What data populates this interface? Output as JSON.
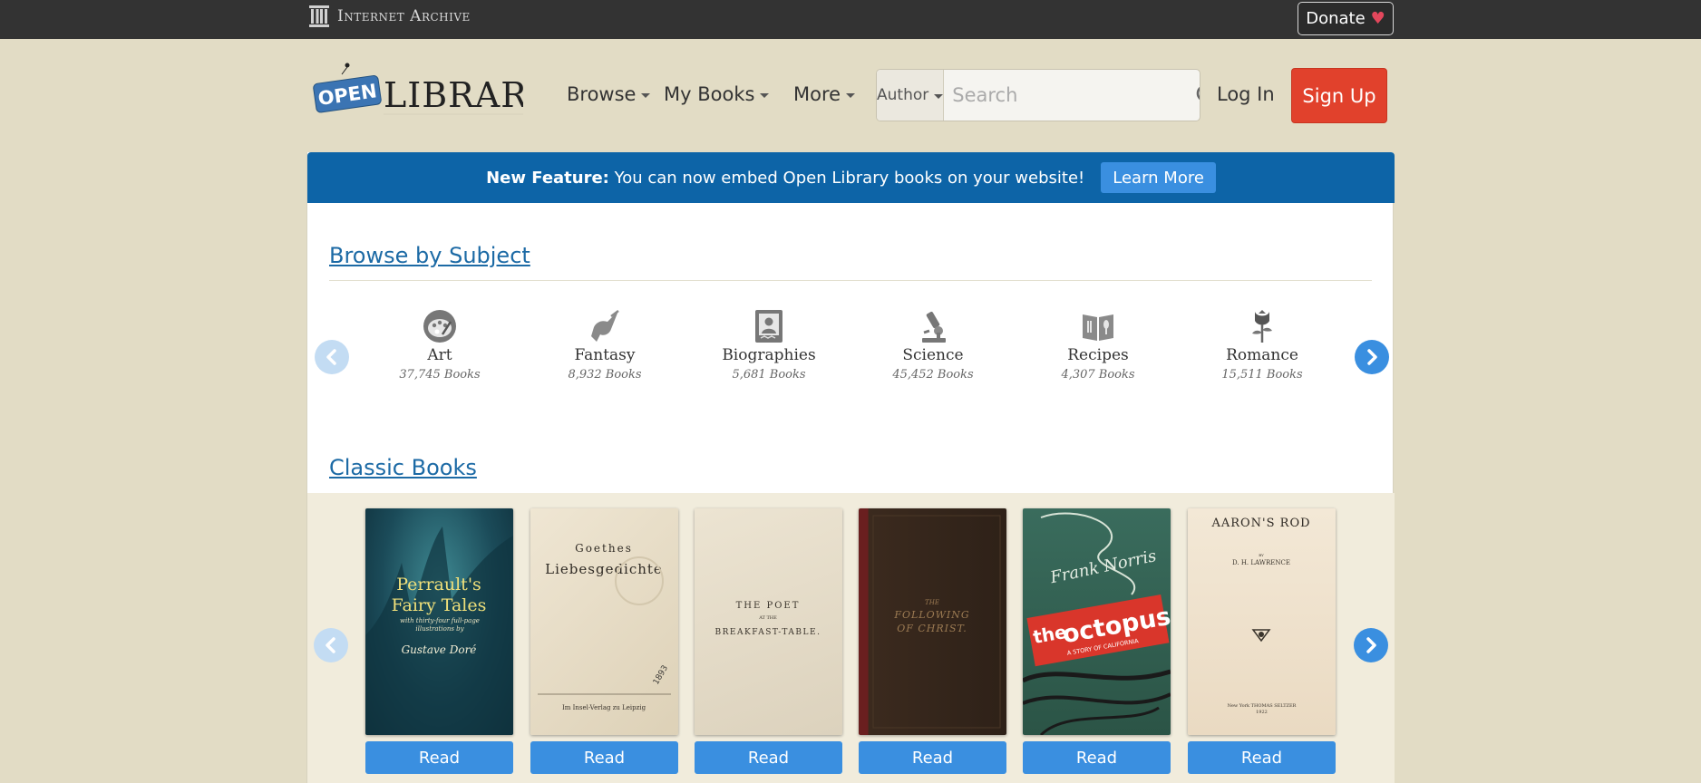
{
  "ia_bar": {
    "logo_text": "Internet Archive",
    "donate_label": "Donate",
    "donate_heart": "♥"
  },
  "header": {
    "logo_open": "OPEN",
    "logo_library": "LIBRARY",
    "nav": [
      {
        "label": "Browse"
      },
      {
        "label": "My Books"
      },
      {
        "label": "More"
      }
    ],
    "search": {
      "mode": "Author",
      "placeholder": "Search"
    },
    "login_label": "Log In",
    "signup_label": "Sign Up"
  },
  "banner": {
    "bold": "New Feature:",
    "text": "You can now embed Open Library books on your website!",
    "button": "Learn More"
  },
  "browse_subject": {
    "title": "Browse by Subject",
    "subjects": [
      {
        "name": "Art",
        "count": "37,745 Books",
        "icon": "palette-icon"
      },
      {
        "name": "Fantasy",
        "count": "8,932 Books",
        "icon": "unicorn-icon"
      },
      {
        "name": "Biographies",
        "count": "5,681 Books",
        "icon": "portrait-book-icon"
      },
      {
        "name": "Science",
        "count": "45,452 Books",
        "icon": "microscope-icon"
      },
      {
        "name": "Recipes",
        "count": "4,307 Books",
        "icon": "cookbook-icon"
      },
      {
        "name": "Romance",
        "count": "15,511 Books",
        "icon": "rose-icon"
      }
    ]
  },
  "classic_books": {
    "title": "Classic Books",
    "read_label": "Read",
    "books": [
      {
        "cover_lines": [
          "Perrault's",
          "Fairy Tales"
        ],
        "sub": "with thirty-four full-page illustrations by",
        "author": "Gustave Doré",
        "color": "#1d4f5c"
      },
      {
        "cover_lines": [
          "Goethes",
          "Liebesgedichte"
        ],
        "sub": "Im Insel-Verlag zu Leipzig",
        "author": "",
        "color": "#e9e0cc"
      },
      {
        "cover_lines": [
          "THE POET",
          "BREAKFAST-TABLE."
        ],
        "sub": "AT THE",
        "author": "",
        "color": "#e6decb"
      },
      {
        "cover_lines": [
          "THE",
          "FOLLOWING",
          "OF CHRIST."
        ],
        "sub": "",
        "author": "",
        "color": "#3a2a1f"
      },
      {
        "cover_lines": [
          "Frank Norris",
          "the",
          "octopus"
        ],
        "sub": "A STORY OF CALIFORNIA",
        "author": "",
        "color": "#2f5a4c"
      },
      {
        "cover_lines": [
          "AARON'S ROD"
        ],
        "sub": "BY",
        "author": "D. H. LAWRENCE",
        "publisher": "New York THOMAS SELTZER 1922",
        "color": "#efe3cf"
      }
    ]
  }
}
